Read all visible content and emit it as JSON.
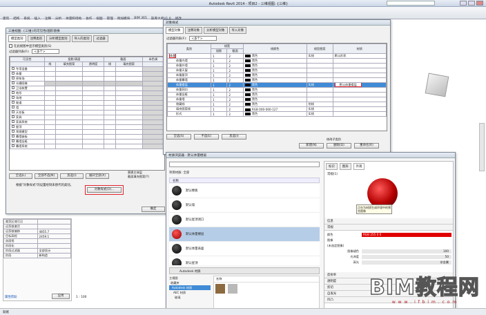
{
  "app": {
    "title": "Autodesk Revit 2014 -    项目2 - 三维视图: {三维}"
  },
  "ribbon": {
    "tabs": [
      "建筑",
      "结构",
      "系统",
      "插入",
      "注释",
      "分析",
      "体量和场地",
      "协作",
      "视图",
      "管理",
      "附加模块",
      "BIM 365",
      "族库大师V1.0",
      "修改"
    ]
  },
  "vg": {
    "title": "三维视图: {三维}的可见性/图形替换",
    "tabs": [
      "模型类别",
      "注释类别",
      "分析模型类别",
      "导入的类别",
      "过滤器"
    ],
    "checkbox_label": "在此视图中显示模型类别(S)",
    "filter_label": "过滤器列表(F):",
    "filter_value": "<多个>",
    "columns": [
      "可见性",
      "投影/表面",
      "截面",
      "半色调"
    ],
    "subcols": [
      "线",
      "填充图案",
      "透明度",
      "线",
      "填充图案"
    ],
    "rows": [
      "专用设备",
      "体量",
      "停车场",
      "光栅图像",
      "卫浴装置",
      "地形",
      "场地",
      "坡道",
      "墙",
      "天花板",
      "家具",
      "家具系统",
      "屋顶",
      "常规模型",
      "幕墙嵌板",
      "幕墙竖梃",
      "幕墙系统"
    ],
    "buttons": [
      "全选(L)",
      "全部不选(N)",
      "反选(I)",
      "展开全部(X)"
    ],
    "note": "根据\"对象样式\"的设置绘制未替代的类别。",
    "obj_style_btn": "对象样式(O)...",
    "ok": "确定",
    "replace_host": "替换主体层",
    "cut_pattern": "截面填充图案(Y)"
  },
  "os": {
    "title": "对象样式",
    "tabs": [
      "模型对象",
      "注释对象",
      "分析模型对象",
      "导入对象"
    ],
    "filter_label": "过滤器列表(F):",
    "filter_value": "<多个>",
    "headers": [
      "类别",
      "线宽",
      "线颜色",
      "线型图案",
      "材质"
    ],
    "subheaders": [
      "投影",
      "截面"
    ],
    "rows": [
      {
        "name": "体量",
        "proj": "1",
        "cut": "2",
        "color": "黑色",
        "pattern": "实线",
        "material": "默认形状"
      },
      {
        "name": "体量内墙",
        "proj": "1",
        "cut": "2",
        "color": "黑色",
        "pattern": "",
        "material": ""
      },
      {
        "name": "体量外墙",
        "proj": "1",
        "cut": "2",
        "color": "黑色",
        "pattern": "",
        "material": ""
      },
      {
        "name": "体量天窗",
        "proj": "1",
        "cut": "2",
        "color": "黑色",
        "pattern": "",
        "material": ""
      },
      {
        "name": "体量屋顶",
        "proj": "1",
        "cut": "2",
        "color": "黑色",
        "pattern": "",
        "material": ""
      },
      {
        "name": "体量幕墙",
        "proj": "1",
        "cut": "2",
        "color": "黑色",
        "pattern": "",
        "material": ""
      },
      {
        "name": "体量楼层",
        "proj": "1",
        "cut": "2",
        "color": "黑色",
        "pattern": "实线",
        "material": "默认体量楼层"
      },
      {
        "name": "体量洞口",
        "proj": "1",
        "cut": "2",
        "color": "黑色",
        "pattern": "",
        "material": ""
      },
      {
        "name": "体量竖梃",
        "proj": "1",
        "cut": "2",
        "color": "黑色",
        "pattern": "",
        "material": ""
      },
      {
        "name": "体量墙",
        "proj": "1",
        "cut": "2",
        "color": "黑色",
        "pattern": "",
        "material": ""
      },
      {
        "name": "隐藏线",
        "proj": "1",
        "cut": "2",
        "color": "黑色",
        "pattern": "划线",
        "material": ""
      },
      {
        "name": "填充图案线",
        "proj": "1",
        "cut": "2",
        "color": "RGB 000-000-127",
        "pattern": "实线",
        "material": ""
      },
      {
        "name": "形式",
        "proj": "1",
        "cut": "2",
        "color": "黑色",
        "pattern": "实线",
        "material": ""
      }
    ],
    "buttons": [
      "全选(S)",
      "不选(E)",
      "反选(I)"
    ],
    "modify_label": "修改子类别",
    "sub_buttons": [
      "新建(N)",
      "删除(D)",
      "重命名(R)"
    ]
  },
  "mb": {
    "title": "材质浏览器 - 默认体量楼层",
    "search_placeholder": "",
    "project_materials": "项目材质: 全部",
    "col_name": "名称",
    "items": [
      "默认楼板",
      "默认墙",
      "默认屋顶洞口",
      "默认体量楼层",
      "默认体量表面",
      "默认屋顶",
      "默认形状"
    ],
    "tabs_right": [
      "标识",
      "图形",
      "外观"
    ],
    "asset_name": "常规(1)",
    "preview_text": "正在为材质生成环境中的预览图像",
    "sections": [
      "信息",
      "常规"
    ],
    "fields": [
      {
        "label": "颜色",
        "value": "RGB 255 0 0"
      },
      {
        "label": "图像",
        "value": ""
      },
      {
        "label": "(未选定图像)",
        "value": ""
      },
      {
        "label": "图像褪色",
        "value": "100"
      },
      {
        "label": "光泽度",
        "value": "50"
      },
      {
        "label": "高光",
        "value": "非金属"
      }
    ],
    "lower_sections": [
      "反射率",
      "透明度",
      "剪切",
      "自发光",
      "凹凸"
    ],
    "library_title": "Autodesk 材质",
    "library_tree": [
      "主视图",
      "收藏夹",
      "Autodesk 材质",
      "AEC 材质",
      "玻璃"
    ],
    "library_col": "名称"
  },
  "props": {
    "rows": [
      {
        "label": "裁剪区域可见",
        "value": ""
      },
      {
        "label": "远剪裁激活",
        "value": ""
      },
      {
        "label": "远剪裁偏移",
        "value": "4855.7"
      },
      {
        "label": "目标高程",
        "value": "2459.1"
      },
      {
        "label": "剖面框",
        "value": ""
      },
      {
        "label": "阶段化",
        "value": ""
      },
      {
        "label": "阶段过滤器",
        "value": "全部显示"
      },
      {
        "label": "阶段",
        "value": "新构造"
      }
    ],
    "help_link": "属性帮助",
    "apply": "应用"
  },
  "statusbar": {
    "text": "就绪",
    "scale": "1 : 100"
  },
  "watermark": {
    "main": "BIM教程网",
    "sub": "w w w . i f b i m . c o m"
  },
  "colors": {
    "accent_red": "#e4222a",
    "select_blue": "#3f8bd6",
    "red_fill": "#e00000"
  }
}
